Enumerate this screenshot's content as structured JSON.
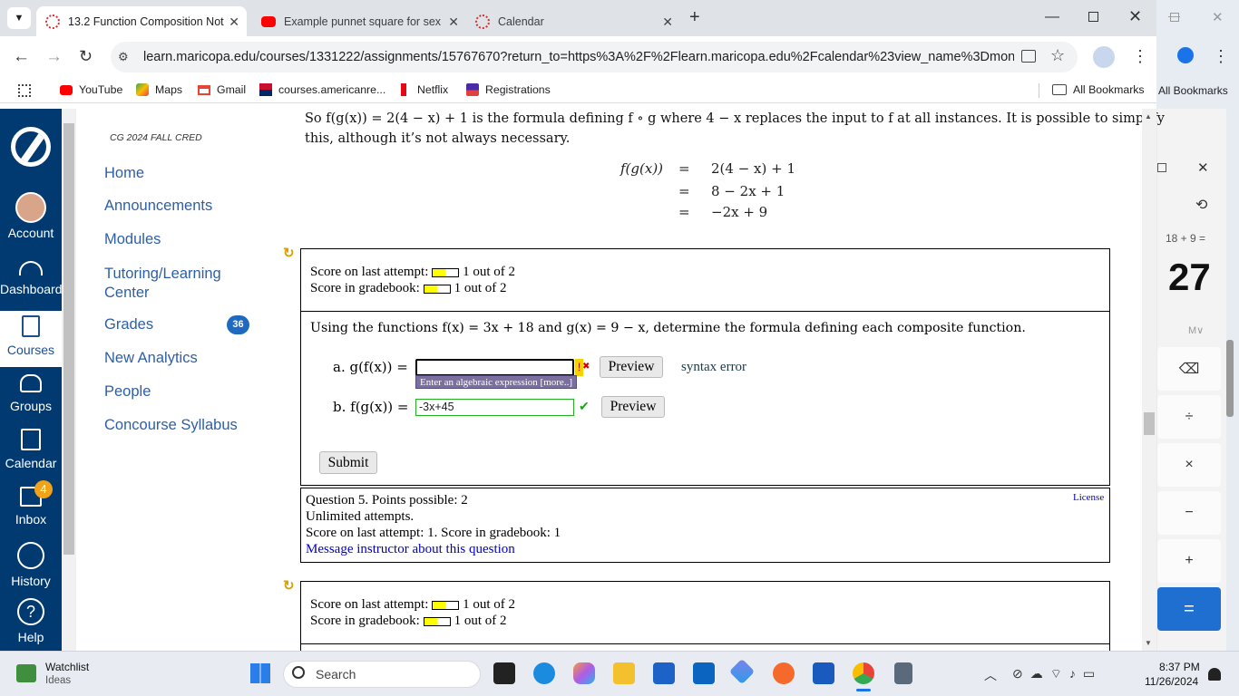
{
  "browser": {
    "tabs": [
      {
        "title": "13.2 Function Composition Not",
        "active": true
      },
      {
        "title": "Example punnet square for sex",
        "active": false
      },
      {
        "title": "Calendar",
        "active": false
      }
    ],
    "url": "learn.maricopa.edu/courses/1331222/assignments/15767670?return_to=https%3A%2F%2Flearn.maricopa.edu%2Fcalendar%23view_name%3Dmonth%2...",
    "bookmarks": [
      "YouTube",
      "Maps",
      "Gmail",
      "courses.americanre...",
      "Netflix",
      "Registrations"
    ],
    "all_bookmarks": "All Bookmarks"
  },
  "calculator": {
    "expression": "18 + 9 =",
    "result": "27",
    "memory": "M∨",
    "keys": [
      "⌫",
      "÷",
      "×",
      "−",
      "+",
      "="
    ]
  },
  "global_nav": [
    {
      "label": "Account",
      "icon": "account-avatar-icon"
    },
    {
      "label": "Dashboard",
      "icon": "dashboard-icon"
    },
    {
      "label": "Courses",
      "icon": "courses-icon",
      "active": true
    },
    {
      "label": "Groups",
      "icon": "groups-icon"
    },
    {
      "label": "Calendar",
      "icon": "calendar-icon"
    },
    {
      "label": "Inbox",
      "icon": "inbox-icon",
      "badge": "4"
    },
    {
      "label": "History",
      "icon": "history-icon"
    },
    {
      "label": "Help",
      "icon": "help-icon"
    }
  ],
  "course": {
    "term": "CG 2024 FALL CRED",
    "nav": [
      "Home",
      "Announcements",
      "Modules",
      "Tutoring/Learning Center",
      "Grades",
      "New Analytics",
      "People",
      "Concourse Syllabus"
    ],
    "grades_badge": "36"
  },
  "content": {
    "intro_1": "So f(g(x)) = 2(4 − x) + 1 is the formula defining f ∘ g where 4 − x replaces the input to f at all instances. It is possible to simplify",
    "intro_2": "this, although it’s not always necessary.",
    "derivation": {
      "lhs": "f(g(x))",
      "eq": "=",
      "lines": [
        "2(4 − x) + 1",
        "8 − 2x + 1",
        "−2x + 9"
      ]
    },
    "q4": {
      "score_last_label": "Score on last attempt:",
      "score_last": "1 out of 2",
      "score_gb_label": "Score in gradebook:",
      "score_gb": "1 out of 2",
      "prompt": "Using the functions f(x) = 3x + 18 and g(x) = 9 − x, determine the formula defining each composite function.",
      "a_label": "a. g(f(x)) =",
      "a_value": "",
      "a_hint": "Enter an algebraic expression [more..]",
      "a_status": "syntax error",
      "b_label": "b. f(g(x)) =",
      "b_value": "-3x+45",
      "preview": "Preview",
      "submit": "Submit"
    },
    "q5": {
      "line1": "Question 5. Points possible: 2",
      "line2": "Unlimited attempts.",
      "line3": "Score on last attempt: 1. Score in gradebook: 1",
      "message_link": "Message instructor about this question",
      "license": "License",
      "score_last_label": "Score on last attempt:",
      "score_last": "1 out of 2",
      "score_gb_label": "Score in gradebook:",
      "score_gb": "1 out of 2"
    }
  },
  "taskbar": {
    "weather_title": "Watchlist",
    "weather_sub": "Ideas",
    "search": "Search",
    "time": "8:37 PM",
    "date": "11/26/2024"
  }
}
